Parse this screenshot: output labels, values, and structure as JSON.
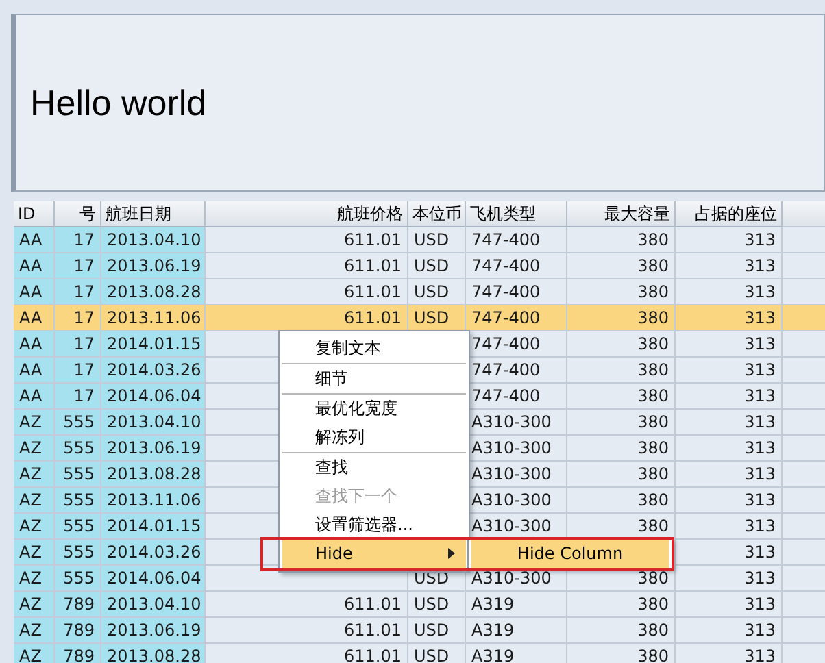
{
  "panel": {
    "title": "Hello world"
  },
  "table": {
    "columns": [
      {
        "label": "ID",
        "kind": "key"
      },
      {
        "label": "号",
        "kind": "key-number"
      },
      {
        "label": "航班日期",
        "kind": "key"
      },
      {
        "label": "航班价格",
        "kind": "number"
      },
      {
        "label": "本位币",
        "kind": "text"
      },
      {
        "label": "飞机类型",
        "kind": "text"
      },
      {
        "label": "最大容量",
        "kind": "number"
      },
      {
        "label": "占据的座位",
        "kind": "number"
      }
    ],
    "rows": [
      {
        "selected": false,
        "cells": [
          "AA",
          "17",
          "2013.04.10",
          "611.01",
          "USD",
          "747-400",
          "380",
          "313"
        ]
      },
      {
        "selected": false,
        "cells": [
          "AA",
          "17",
          "2013.06.19",
          "611.01",
          "USD",
          "747-400",
          "380",
          "313"
        ]
      },
      {
        "selected": false,
        "cells": [
          "AA",
          "17",
          "2013.08.28",
          "611.01",
          "USD",
          "747-400",
          "380",
          "313"
        ]
      },
      {
        "selected": true,
        "cells": [
          "AA",
          "17",
          "2013.11.06",
          "611.01",
          "USD",
          "747-400",
          "380",
          "313"
        ]
      },
      {
        "selected": false,
        "cells": [
          "AA",
          "17",
          "2014.01.15",
          null,
          null,
          "747-400",
          "380",
          "313"
        ]
      },
      {
        "selected": false,
        "cells": [
          "AA",
          "17",
          "2014.03.26",
          null,
          null,
          "747-400",
          "380",
          "313"
        ]
      },
      {
        "selected": false,
        "cells": [
          "AA",
          "17",
          "2014.06.04",
          null,
          null,
          "747-400",
          "380",
          "313"
        ]
      },
      {
        "selected": false,
        "cells": [
          "AZ",
          "555",
          "2013.04.10",
          null,
          null,
          "A310-300",
          "380",
          "313"
        ]
      },
      {
        "selected": false,
        "cells": [
          "AZ",
          "555",
          "2013.06.19",
          null,
          null,
          "A310-300",
          "380",
          "313"
        ]
      },
      {
        "selected": false,
        "cells": [
          "AZ",
          "555",
          "2013.08.28",
          null,
          null,
          "A310-300",
          "380",
          "313"
        ]
      },
      {
        "selected": false,
        "cells": [
          "AZ",
          "555",
          "2013.11.06",
          null,
          null,
          "A310-300",
          "380",
          "313"
        ]
      },
      {
        "selected": false,
        "cells": [
          "AZ",
          "555",
          "2014.01.15",
          null,
          null,
          "A310-300",
          "380",
          "313"
        ]
      },
      {
        "selected": false,
        "cells": [
          "AZ",
          "555",
          "2014.03.26",
          null,
          null,
          null,
          null,
          "313"
        ]
      },
      {
        "selected": false,
        "cells": [
          "AZ",
          "555",
          "2014.06.04",
          null,
          "USD",
          "A310-300",
          "380",
          "313"
        ]
      },
      {
        "selected": false,
        "cells": [
          "AZ",
          "789",
          "2013.04.10",
          "611.01",
          "USD",
          "A319",
          "380",
          "313"
        ]
      },
      {
        "selected": false,
        "cells": [
          "AZ",
          "789",
          "2013.06.19",
          "611.01",
          "USD",
          "A319",
          "380",
          "313"
        ]
      },
      {
        "selected": false,
        "cells": [
          "AZ",
          "789",
          "2013.08.28",
          "611.01",
          "USD",
          "A319",
          "380",
          "313"
        ]
      }
    ]
  },
  "context_menu": {
    "items": [
      {
        "label": "复制文本",
        "disabled": false,
        "selected": false,
        "separator_after": true,
        "has_submenu": false
      },
      {
        "label": "细节",
        "disabled": false,
        "selected": false,
        "separator_after": true,
        "has_submenu": false
      },
      {
        "label": "最优化宽度",
        "disabled": false,
        "selected": false,
        "separator_after": false,
        "has_submenu": false
      },
      {
        "label": "解冻列",
        "disabled": false,
        "selected": false,
        "separator_after": true,
        "has_submenu": false
      },
      {
        "label": "查找",
        "disabled": false,
        "selected": false,
        "separator_after": false,
        "has_submenu": false
      },
      {
        "label": "查找下一个",
        "disabled": true,
        "selected": false,
        "separator_after": false,
        "has_submenu": false
      },
      {
        "label": "设置筛选器...",
        "disabled": false,
        "selected": false,
        "separator_after": false,
        "has_submenu": false
      },
      {
        "label": "Hide",
        "disabled": false,
        "selected": true,
        "separator_after": false,
        "has_submenu": true
      }
    ]
  },
  "submenu": {
    "items": [
      {
        "label": "Hide Column",
        "selected": true
      }
    ]
  }
}
